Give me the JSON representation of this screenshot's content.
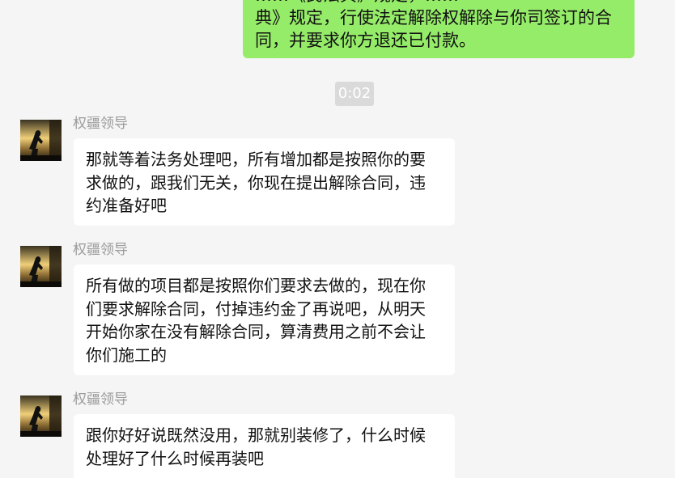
{
  "sent_message": {
    "lines": [
      "……《民法典》规定，……",
      "典》规定，行使法定解除权解除与你司签订的合",
      "同，并要求你方退还已付款。"
    ]
  },
  "timestamp": "0:02",
  "messages": [
    {
      "sender": "权疆领导",
      "lines": [
        "那就等着法务处理吧，所有增加都是按照你的要",
        "求做的，跟我们无关，你现在提出解除合同，违",
        "约准备好吧"
      ]
    },
    {
      "sender": "权疆领导",
      "lines": [
        "所有做的项目都是按照你们要求去做的，现在你",
        "们要求解除合同，付掉违约金了再说吧，从明天",
        "开始你家在没有解除合同，算清费用之前不会让",
        "你们施工的"
      ]
    },
    {
      "sender": "权疆领导",
      "lines": [
        "跟你好好说既然没用，那就别装修了，什么时候",
        "处理好了什么时候再装吧"
      ]
    }
  ],
  "colors": {
    "background": "#f5f5f5",
    "sent_bubble": "#95ec69",
    "received_bubble": "#ffffff",
    "sender_name": "#9b9b9b",
    "timestamp_bg": "#dadada"
  }
}
